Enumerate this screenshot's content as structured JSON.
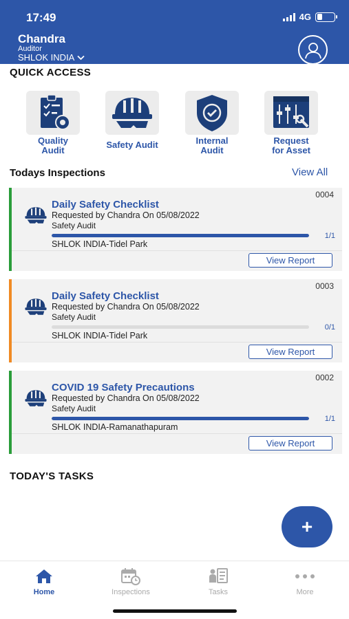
{
  "status_bar": {
    "time": "17:49",
    "network": "4G"
  },
  "header": {
    "user_name": "Chandra",
    "role": "Auditor",
    "company": "SHLOK INDIA"
  },
  "quick_access": {
    "title": "QUICK ACCESS",
    "items": [
      {
        "label": "Quality\nAudit",
        "icon": "quality-audit-icon"
      },
      {
        "label": "Safety Audit",
        "icon": "safety-helmet-icon"
      },
      {
        "label": "Internal\nAudit",
        "icon": "shield-check-icon"
      },
      {
        "label": "Request\nfor Asset",
        "icon": "asset-request-icon"
      }
    ]
  },
  "inspections": {
    "title": "Todays Inspections",
    "view_all": "View All",
    "cards": [
      {
        "number": "0004",
        "title": "Daily Safety Checklist",
        "requested": "Requested by Chandra On  05/08/2022",
        "type": "Safety Audit",
        "progress_text": "1/1",
        "progress": 1.0,
        "location": "SHLOK INDIA-Tidel Park",
        "button": "View Report",
        "accent": "#2a9d3a"
      },
      {
        "number": "0003",
        "title": "Daily Safety Checklist",
        "requested": "Requested by Chandra On  05/08/2022",
        "type": "Safety Audit",
        "progress_text": "0/1",
        "progress": 0.0,
        "location": "SHLOK INDIA-Tidel Park",
        "button": "View Report",
        "accent": "#f08a24"
      },
      {
        "number": "0002",
        "title": "COVID 19 Safety Precautions",
        "requested": "Requested by Chandra On  05/08/2022",
        "type": "Safety Audit",
        "progress_text": "1/1",
        "progress": 1.0,
        "location": "SHLOK INDIA-Ramanathapuram",
        "button": "View Report",
        "accent": "#2a9d3a"
      }
    ]
  },
  "tasks": {
    "title": "TODAY'S TASKS"
  },
  "fab": {
    "label": "+"
  },
  "bottom_nav": {
    "items": [
      {
        "label": "Home",
        "active": true
      },
      {
        "label": "Inspections",
        "active": false
      },
      {
        "label": "Tasks",
        "active": false
      },
      {
        "label": "More",
        "active": false
      }
    ]
  },
  "colors": {
    "primary": "#2d56a8",
    "complete": "#2a9d3a",
    "pending": "#f08a24"
  }
}
